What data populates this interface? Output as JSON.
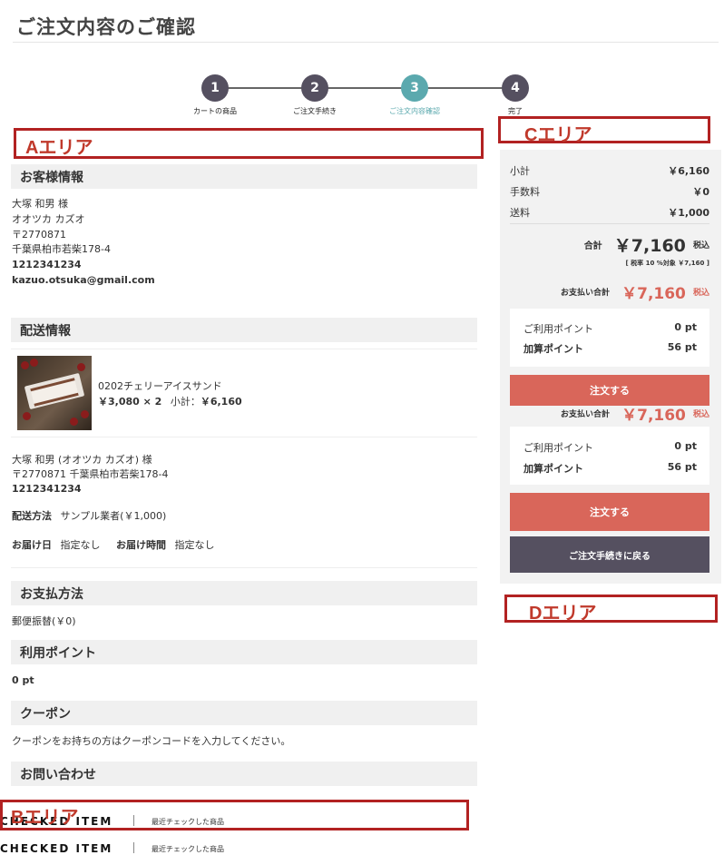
{
  "page_title": "ご注文内容のご確認",
  "steps": [
    {
      "num": "1",
      "label": "カートの商品"
    },
    {
      "num": "2",
      "label": "ご注文手続き"
    },
    {
      "num": "3",
      "label": "ご注文内容確認"
    },
    {
      "num": "4",
      "label": "完了"
    }
  ],
  "annotations": {
    "a": "Aエリア",
    "b": "Bエリア",
    "c": "Cエリア",
    "d": "Dエリア"
  },
  "customer": {
    "heading": "お客様情報",
    "name": "大塚 和男 様",
    "kana": "オオツカ カズオ",
    "zip": "〒2770871",
    "address": "千葉県柏市若柴178-4",
    "phone": "1212341234",
    "email": "kazuo.otsuka@gmail.com"
  },
  "shipping": {
    "heading": "配送情報",
    "product_name": "0202チェリーアイスサンド",
    "product_price": "￥3,080 × 2",
    "subtotal_label": "小計：",
    "subtotal": "￥6,160",
    "recipient": "大塚 和男 (オオツカ カズオ) 様",
    "address": "〒2770871 千葉県柏市若柴178-4",
    "phone": "1212341234",
    "method_label": "配送方法",
    "method_value": "サンプル業者(￥1,000)",
    "date_label": "お届け日",
    "date_value": "指定なし",
    "time_label": "お届け時間",
    "time_value": "指定なし"
  },
  "payment": {
    "heading": "お支払方法",
    "value": "郵便振替(￥0)"
  },
  "points": {
    "heading": "利用ポイント",
    "value": "0 pt"
  },
  "coupon": {
    "heading": "クーポン",
    "text": "クーポンをお持ちの方はクーポンコードを入力してください。"
  },
  "contact": {
    "heading": "お問い合わせ"
  },
  "checked": {
    "title": "CHECKED ITEM",
    "sub": "最近チェックした商品"
  },
  "summary": {
    "subtotal_label": "小計",
    "subtotal": "￥6,160",
    "fee_label": "手数料",
    "fee": "￥0",
    "shipping_label": "送料",
    "shipping": "￥1,000",
    "total_label": "合計",
    "total": "￥7,160",
    "tax_incl": "税込",
    "tax_note": "[ 税率 10 %対象  ￥7,160 ]",
    "pay_total_label": "お支払い合計",
    "pay_total": "￥7,160",
    "used_points_label": "ご利用ポイント",
    "used_points": "0 pt",
    "add_points_label": "加算ポイント",
    "add_points": "56 pt",
    "order_button": "注文する",
    "back_button": "ご注文手続きに戻る"
  },
  "colors": {
    "accent": "#5ba9ae",
    "order": "#d9665a",
    "dark": "#555060",
    "annotation": "#b22222"
  }
}
